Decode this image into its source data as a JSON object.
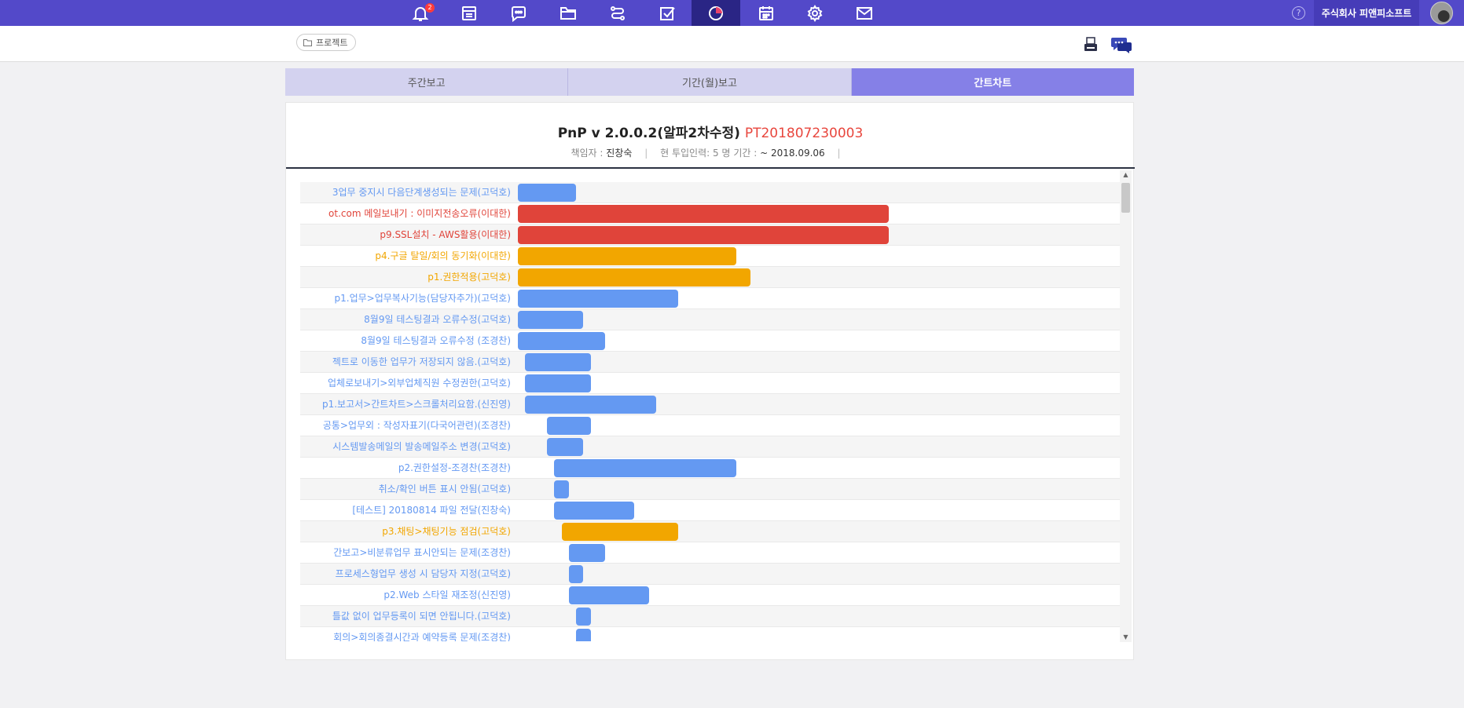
{
  "nav": {
    "icons": [
      "bell-icon",
      "board-icon",
      "chat-icon",
      "folder-icon",
      "flow-icon",
      "checkbox-icon",
      "chart-icon",
      "calendar-icon",
      "gear-icon",
      "mail-icon"
    ],
    "notification_count": "2",
    "active_icon": "chart-icon",
    "help": "?",
    "company": "주식회사 피앤피소프트"
  },
  "breadcrumb": {
    "project_label": "프로젝트"
  },
  "tabs": [
    {
      "label": "주간보고",
      "active": false
    },
    {
      "label": "기간(월)보고",
      "active": false
    },
    {
      "label": "간트차트",
      "active": true
    }
  ],
  "header": {
    "title": "PnP v 2.0.0.2(알파2차수정)",
    "code": "PT201807230003",
    "manager_label": "책임자 :",
    "manager": "진창숙",
    "staff_label": "현 투입인력:",
    "staff_value": "5 명",
    "period_label": "기간 :",
    "period_value": "~ 2018.09.06",
    "sep": "|"
  },
  "colors": {
    "blue": "#6499f2",
    "red": "#e0443a",
    "orange": "#f2a600",
    "nav": "#5349c9",
    "active_tab": "#8580e7"
  },
  "gantt": {
    "tasks": [
      {
        "label": "3업무 중지시 다음단계생성되는 문제(고덕호)",
        "start": 0,
        "length": 4,
        "color": "blue"
      },
      {
        "label": "ot.com 메일보내기 : 이미지전송오류(이대한)",
        "start": 0,
        "length": 25.5,
        "color": "red"
      },
      {
        "label": "p9.SSL설치 - AWS활용(이대한)",
        "start": 0,
        "length": 25.5,
        "color": "red"
      },
      {
        "label": "p4.구글 탈일/회의 동기화(이대한)",
        "start": 0,
        "length": 15,
        "color": "orange"
      },
      {
        "label": "p1.권한적용(고덕호)",
        "start": 0,
        "length": 16,
        "color": "orange"
      },
      {
        "label": "p1.업무>업무복사기능(담당자추가)(고덕호)",
        "start": 0,
        "length": 11,
        "color": "blue"
      },
      {
        "label": "8월9일 테스팅결과 오류수정(고덕호)",
        "start": 0,
        "length": 4.5,
        "color": "blue"
      },
      {
        "label": "8월9일 테스팅결과 오류수정 (조경찬)",
        "start": 0,
        "length": 6,
        "color": "blue"
      },
      {
        "label": "젝트로 이동한 업무가 저장되지 않음.(고덕호)",
        "start": 0.5,
        "length": 4.5,
        "color": "blue"
      },
      {
        "label": "업체로보내기>외부업체직원 수정권한(고덕호)",
        "start": 0.5,
        "length": 4.5,
        "color": "blue"
      },
      {
        "label": "p1.보고서>간트차트>스크롤처리요함.(신진영)",
        "start": 0.5,
        "length": 9,
        "color": "blue"
      },
      {
        "label": "공통>업무외 : 작성자표기(다국어관련)(조경찬)",
        "start": 2,
        "length": 3,
        "color": "blue"
      },
      {
        "label": "시스템발송메일의 발송메일주소 변경(고덕호)",
        "start": 2,
        "length": 2.5,
        "color": "blue"
      },
      {
        "label": "p2.권한설정-조경찬(조경찬)",
        "start": 2.5,
        "length": 12.5,
        "color": "blue"
      },
      {
        "label": "취소/확인 버튼 표시 안됨(고덕호)",
        "start": 2.5,
        "length": 1,
        "color": "blue"
      },
      {
        "label": "[테스트] 20180814 파일 전달(진창숙)",
        "start": 2.5,
        "length": 5.5,
        "color": "blue"
      },
      {
        "label": "p3.채팅>채팅기능 점검(고덕호)",
        "start": 3,
        "length": 8,
        "color": "orange"
      },
      {
        "label": "간보고>비분류업무 표시안되는 문제(조경찬)",
        "start": 3.5,
        "length": 2.5,
        "color": "blue"
      },
      {
        "label": "프로세스형업무 생성 시 담당자 지정(고덕호)",
        "start": 3.5,
        "length": 1,
        "color": "blue"
      },
      {
        "label": "p2.Web 스타일 재조정(신진영)",
        "start": 3.5,
        "length": 5.5,
        "color": "blue"
      },
      {
        "label": "틀값 없이 업무등록이 되면 안됩니다.(고덕호)",
        "start": 4,
        "length": 1,
        "color": "blue"
      },
      {
        "label": "회의>회의종결시간과 예약등록 문제(조경찬)",
        "start": 4,
        "length": 1,
        "color": "blue"
      }
    ]
  },
  "scroll": {
    "up": "▲",
    "down": "▼"
  }
}
